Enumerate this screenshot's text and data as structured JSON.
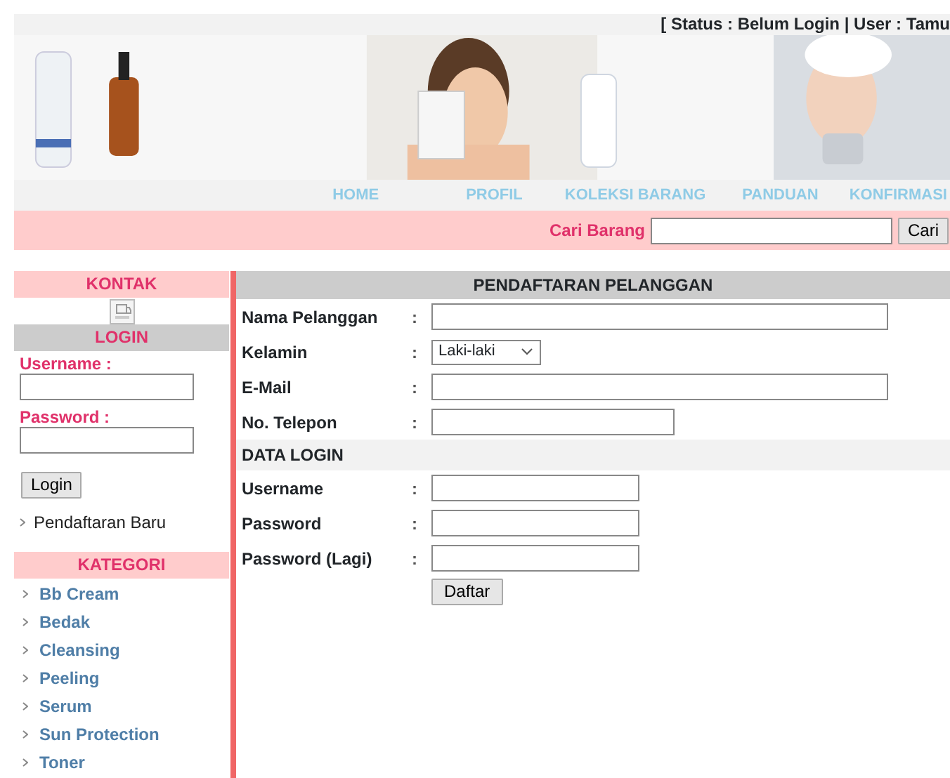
{
  "status_bar": "[ Status : Belum Login | User : Tamu",
  "nav": [
    "HOME",
    "PROFIL",
    "KOLEKSI BARANG",
    "PANDUAN",
    "KONFIRMASI"
  ],
  "search": {
    "label": "Cari Barang",
    "button": "Cari"
  },
  "sidebar": {
    "kontak": {
      "title": "KONTAK"
    },
    "login": {
      "title": "LOGIN",
      "fields": [
        {
          "label": "Username :"
        },
        {
          "label": "Password :"
        }
      ],
      "button": "Login",
      "register_link": "Pendaftaran Baru"
    },
    "kategori": {
      "title": "KATEGORI",
      "items": [
        "Bb Cream",
        "Bedak",
        "Cleansing",
        "Peeling",
        "Serum",
        "Sun Protection",
        "Toner"
      ]
    }
  },
  "form": {
    "title": "PENDAFTARAN PELANGGAN",
    "rows": [
      {
        "kind": "text",
        "label": "Nama Pelanggan",
        "separator": ":"
      },
      {
        "kind": "select",
        "label": "Kelamin",
        "separator": ":",
        "value": "Laki-laki"
      },
      {
        "kind": "text",
        "label": "E-Mail",
        "separator": ":"
      },
      {
        "kind": "text",
        "label": "No. Telepon",
        "separator": ":"
      },
      {
        "kind": "section",
        "label": "DATA LOGIN"
      },
      {
        "kind": "text",
        "label": "Username",
        "separator": ":"
      },
      {
        "kind": "text",
        "label": "Password",
        "separator": ":"
      },
      {
        "kind": "text",
        "label": "Password (Lagi)",
        "separator": ":"
      }
    ],
    "button": "Daftar"
  }
}
